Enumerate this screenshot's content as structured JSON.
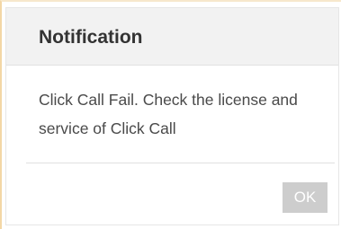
{
  "dialog": {
    "title": "Notification",
    "message": "Click Call Fail. Check the license and service of Click Call",
    "ok_label": "OK"
  },
  "colors": {
    "header_background": "#f2f2f2",
    "title_text": "#333333",
    "body_text": "#4a4a4a",
    "ok_button_background": "#cdcdcd",
    "ok_button_text": "#ffffff",
    "frame_accent": "#f3d7a6"
  }
}
